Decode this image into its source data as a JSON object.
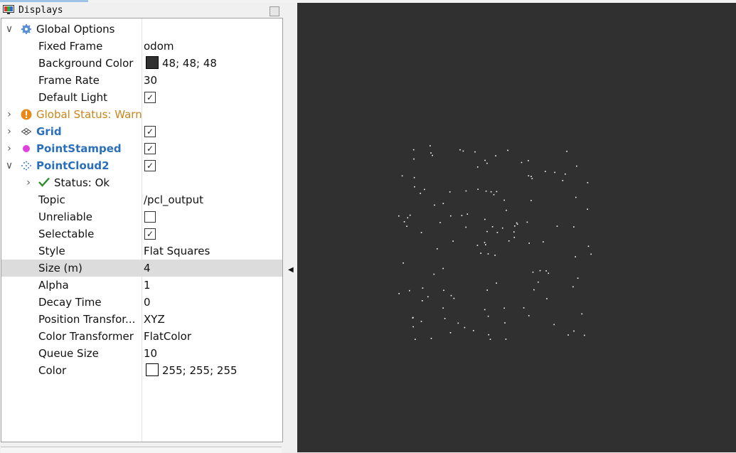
{
  "panel": {
    "title": "Displays"
  },
  "colors": {
    "background": "#303030",
    "point": "#ffffff",
    "link": "#2a6fb8",
    "warn": "#c88518"
  },
  "rows": {
    "global_options": {
      "label": "Global Options"
    },
    "fixed_frame": {
      "label": "Fixed Frame",
      "value": "odom"
    },
    "background_color": {
      "label": "Background Color",
      "value": "48; 48; 48",
      "swatch": "#303030"
    },
    "frame_rate": {
      "label": "Frame Rate",
      "value": "30"
    },
    "default_light": {
      "label": "Default Light",
      "checked": true
    },
    "global_status": {
      "label": "Global Status: Warn"
    },
    "grid": {
      "label": "Grid",
      "checked": true
    },
    "point_stamped": {
      "label": "PointStamped",
      "checked": true
    },
    "point_cloud2": {
      "label": "PointCloud2",
      "checked": true
    },
    "status": {
      "label": "Status: Ok"
    },
    "topic": {
      "label": "Topic",
      "value": "/pcl_output"
    },
    "unreliable": {
      "label": "Unreliable",
      "checked": false
    },
    "selectable": {
      "label": "Selectable",
      "checked": true
    },
    "style": {
      "label": "Style",
      "value": "Flat Squares"
    },
    "size": {
      "label": "Size (m)",
      "value": "4"
    },
    "alpha": {
      "label": "Alpha",
      "value": "1"
    },
    "decay_time": {
      "label": "Decay Time",
      "value": "0"
    },
    "position_transformer": {
      "label": "Position Transfor...",
      "value": "XYZ"
    },
    "color_transformer": {
      "label": "Color Transformer",
      "value": "FlatColor"
    },
    "queue_size": {
      "label": "Queue Size",
      "value": "10"
    },
    "color": {
      "label": "Color",
      "value": "255; 255; 255",
      "swatch": "#ffffff"
    }
  },
  "icons": {
    "global_options": "gear-icon",
    "global_status": "warning-icon",
    "grid": "grid-icon",
    "point_stamped": "point-icon",
    "point_cloud2": "pointcloud-icon",
    "status": "checkmark-icon"
  }
}
